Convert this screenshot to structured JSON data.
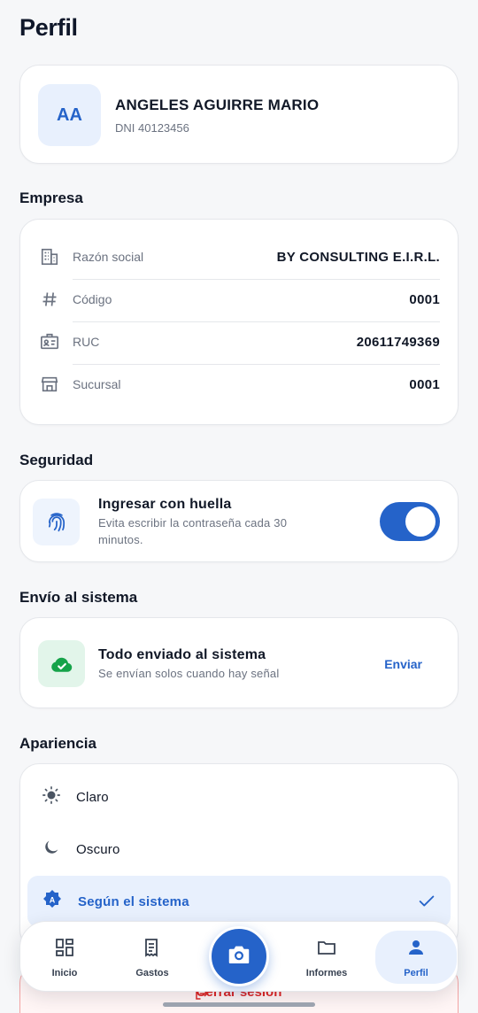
{
  "page": {
    "title": "Perfil"
  },
  "profile": {
    "initials": "AA",
    "name": "ANGELES AGUIRRE MARIO",
    "dni": "DNI 40123456"
  },
  "company": {
    "title": "Empresa",
    "rows": [
      {
        "icon": "building-icon",
        "label": "Razón social",
        "value": "BY CONSULTING E.I.R.L."
      },
      {
        "icon": "hash-icon",
        "label": "Código",
        "value": "0001"
      },
      {
        "icon": "id-card-icon",
        "label": "RUC",
        "value": "20611749369"
      },
      {
        "icon": "store-icon",
        "label": "Sucursal",
        "value": "0001"
      }
    ]
  },
  "security": {
    "title": "Seguridad",
    "fingerprint": {
      "icon": "fingerprint-icon",
      "label": "Ingresar con huella",
      "description": "Evita escribir la contraseña cada 30 minutos.",
      "enabled": true
    }
  },
  "send": {
    "title": "Envío al sistema",
    "icon": "cloud-check-icon",
    "status": "Todo enviado al sistema",
    "description": "Se envían solos cuando hay señal",
    "button": "Enviar"
  },
  "appearance": {
    "title": "Apariencia",
    "options": [
      {
        "icon": "sun-icon",
        "label": "Claro",
        "selected": false
      },
      {
        "icon": "moon-icon",
        "label": "Oscuro",
        "selected": false
      },
      {
        "icon": "auto-theme-icon",
        "label": "Según el sistema",
        "selected": true
      }
    ]
  },
  "logout": {
    "label": "Cerrar sesión"
  },
  "nav": {
    "items": [
      {
        "icon": "dashboard-icon",
        "label": "Inicio"
      },
      {
        "icon": "receipt-icon",
        "label": "Gastos"
      },
      {
        "icon": "camera-icon",
        "label": ""
      },
      {
        "icon": "folder-icon",
        "label": "Informes"
      },
      {
        "icon": "person-icon",
        "label": "Perfil"
      }
    ],
    "active": "Perfil"
  },
  "colors": {
    "accent": "#2563c9",
    "accent_light": "#e8f0fd",
    "success": "#16a34a",
    "danger": "#dc2626",
    "background": "#f6f7f9"
  }
}
